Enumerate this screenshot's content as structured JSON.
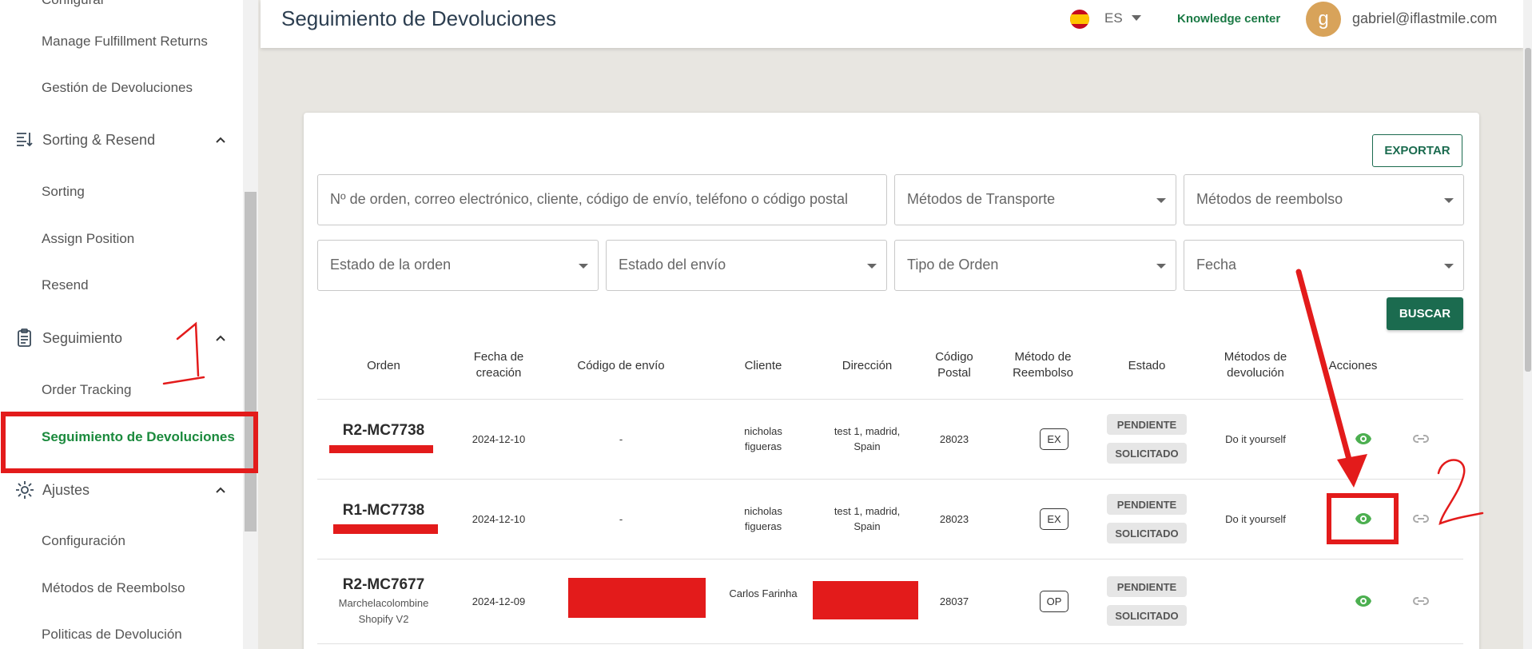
{
  "sidebar": {
    "partial_top_label": "Configurar",
    "items": [
      {
        "label": "Manage Fulfillment Returns"
      },
      {
        "label": "Gestión de Devoluciones"
      },
      {
        "label": "Sorting"
      },
      {
        "label": "Assign Position"
      },
      {
        "label": "Resend"
      },
      {
        "label": "Order Tracking"
      },
      {
        "label": "Seguimiento de Devoluciones"
      },
      {
        "label": "Configuración"
      },
      {
        "label": "Métodos de Reembolso"
      },
      {
        "label": "Politicas de Devolución"
      }
    ],
    "sections": [
      {
        "label": "Sorting & Resend",
        "icon": "sorting-icon"
      },
      {
        "label": "Seguimiento",
        "icon": "clipboard-icon"
      },
      {
        "label": "Ajustes",
        "icon": "gear-icon"
      }
    ],
    "active_color": "#1b8a3d"
  },
  "header": {
    "title": "Seguimiento de Devoluciones",
    "language": "ES",
    "knowledge_center": "Knowledge center",
    "avatar_letter": "g",
    "email": "gabriel@iflastmile.com"
  },
  "toolbar": {
    "export_label": "EXPORTAR",
    "search_label": "BUSCAR"
  },
  "filters": {
    "search_placeholder": "Nº de orden, correo electrónico, cliente, código de envío, teléfono o código postal",
    "transport": "Métodos de Transporte",
    "refund": "Métodos de reembolso",
    "order_state": "Estado de la orden",
    "shipment_state": "Estado del envío",
    "order_type": "Tipo de Orden",
    "date": "Fecha"
  },
  "table": {
    "headers": [
      "Orden",
      "Fecha de creación",
      "Código de envío",
      "Cliente",
      "Dirección",
      "Código Postal",
      "Método de Reembolso",
      "Estado",
      "Métodos de devolución",
      "Acciones"
    ],
    "rows": [
      {
        "order": "R2-MC7738",
        "order_sub": "",
        "date": "2024-12-10",
        "shipping_code": "-",
        "client": "nicholas figueras",
        "address": "test 1, madrid, Spain",
        "postal": "28023",
        "refund": "EX",
        "status_1": "PENDIENTE",
        "status_2": "SOLICITADO",
        "return_method": "Do it yourself"
      },
      {
        "order": "R1-MC7738",
        "order_sub": "",
        "date": "2024-12-10",
        "shipping_code": "-",
        "client": "nicholas figueras",
        "address": "test 1, madrid, Spain",
        "postal": "28023",
        "refund": "EX",
        "status_1": "PENDIENTE",
        "status_2": "SOLICITADO",
        "return_method": "Do it yourself"
      },
      {
        "order": "R2-MC7677",
        "order_sub": "Marchelacolombine Shopify V2",
        "date": "2024-12-09",
        "shipping_code": "",
        "client": "Carlos Farinha",
        "address": "",
        "postal": "28037",
        "refund": "OP",
        "status_1": "PENDIENTE",
        "status_2": "SOLICITADO",
        "return_method": ""
      }
    ]
  },
  "annotations": {
    "mark_1": "1",
    "mark_2": "2",
    "color": "#e31b1b"
  },
  "colors": {
    "primary": "#1b6b4f",
    "eye": "#4caf50",
    "background": "#e8e6e1"
  }
}
